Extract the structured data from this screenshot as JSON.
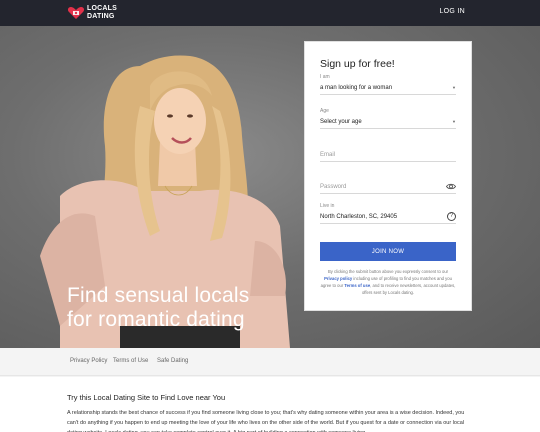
{
  "header": {
    "logo_line1": "LOCALS",
    "logo_line2": "DATING",
    "login_label": "LOG IN"
  },
  "hero": {
    "headline_line1": "Find sensual locals",
    "headline_line2": "for romantic dating"
  },
  "signup": {
    "title": "Sign up for free!",
    "i_am_label": "I am",
    "i_am_value": "a man looking for a woman",
    "age_label": "Age",
    "age_value": "Select your age",
    "email_placeholder": "Email",
    "password_placeholder": "Password",
    "live_in_label": "Live in",
    "live_in_value": "North Charleston, SC, 29405",
    "join_label": "JOIN NOW",
    "legal_part1": "By clicking the submit button above you expressly consent to our ",
    "legal_privacy": "Privacy policy",
    "legal_part2": " including use of profiling to find you matches and you agree to our ",
    "legal_terms": "Terms of use",
    "legal_part3": ", and to receive newsletters, account updates, offers sent by Locals dating."
  },
  "footer": {
    "links": [
      "Privacy Policy",
      "Terms of Use",
      "Safe Dating"
    ]
  },
  "content": {
    "title": "Try this Local Dating Site to Find Love near You",
    "body": "A relationship stands the best chance of success if you find someone living close to you; that's why dating someone within your area is a wise decision. Indeed, you can't do anything if you happen to end up meeting the love of your life who lives on the other side of the world. But if you quest for a date or connection via our local dating website, Locals dating, you can take complete control over it. A big part of building a connection with someone living"
  },
  "colors": {
    "header_bg": "#23252e",
    "accent": "#3a64c8",
    "logo_red": "#e2314a"
  }
}
